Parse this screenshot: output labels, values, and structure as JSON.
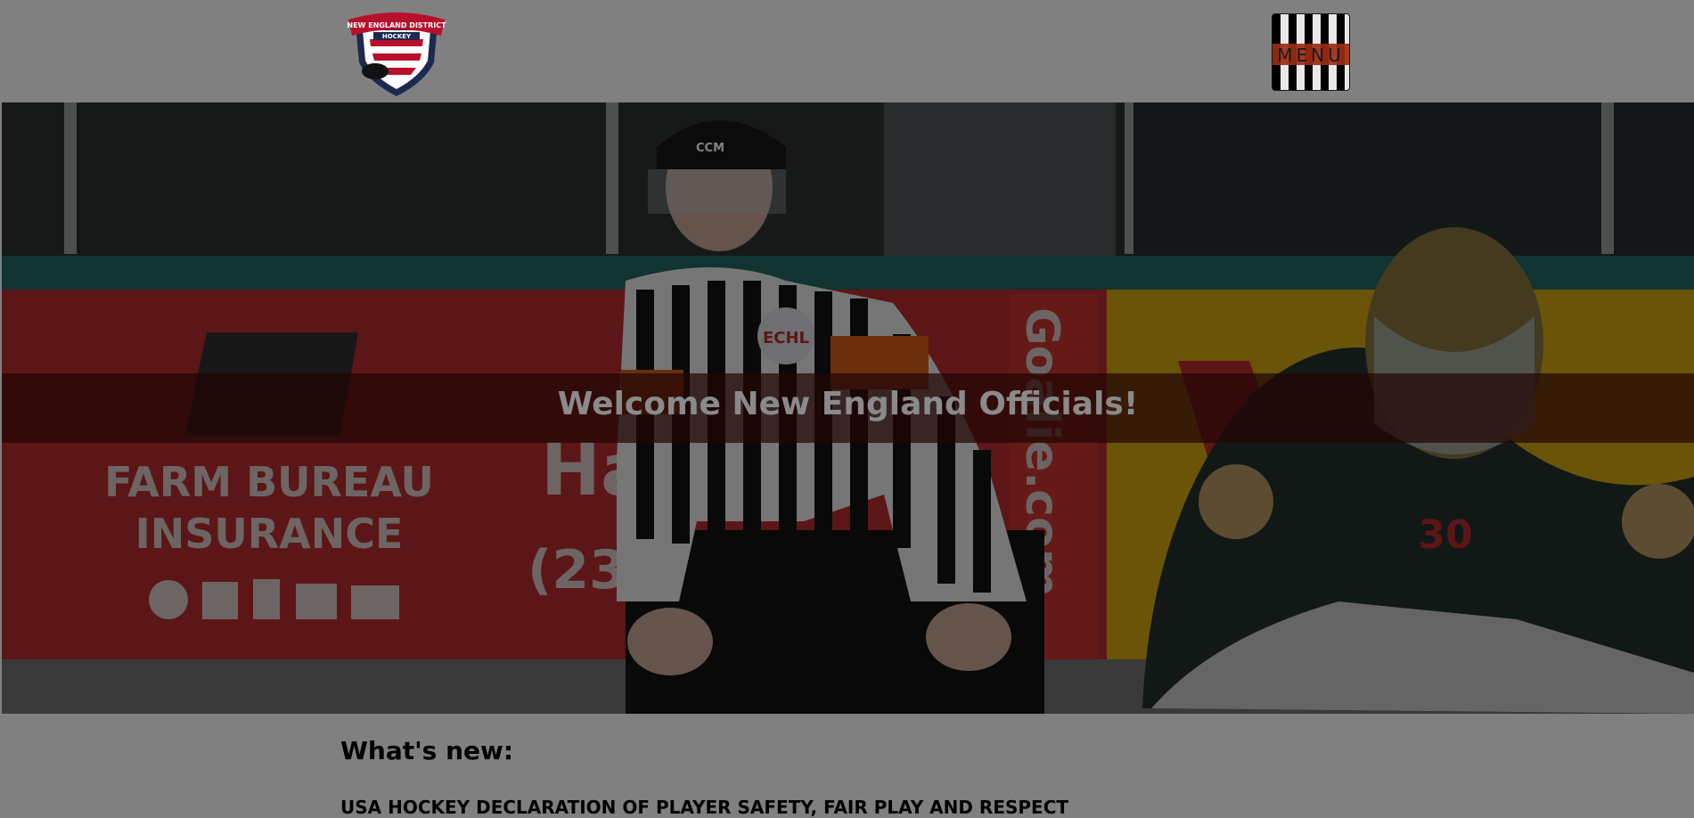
{
  "header": {
    "logo": {
      "icon": "new-england-district-hockey-logo",
      "text_top": "NEW ENGLAND DISTRICT",
      "text_mid": "HOCKEY",
      "colors": {
        "red": "#b8102c",
        "navy": "#1c2a4f",
        "white": "#ffffff"
      }
    },
    "menu_button": {
      "label": "MENU",
      "icon": "referee-stripes-icon"
    }
  },
  "hero": {
    "welcome_text": "Welcome New England Officials!",
    "overlay_color": "#230505",
    "board_text_1": "FARM BUREAU",
    "board_text_2": "INSURANCE",
    "board_text_3": "Ha",
    "board_text_4": "(231)",
    "board_text_5": "Goalie.com",
    "helmet_brand": "CCM",
    "jersey_badge": "ECHL",
    "goalie_number": "30"
  },
  "content": {
    "section_title": "What's new:",
    "news_items": [
      "USA HOCKEY DECLARATION OF PLAYER SAFETY, FAIR PLAY AND RESPECT"
    ]
  }
}
